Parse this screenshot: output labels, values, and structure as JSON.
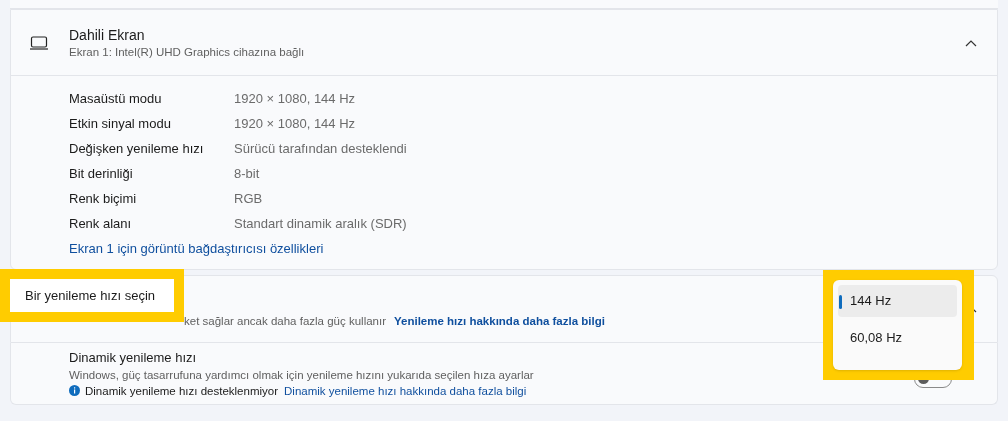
{
  "display": {
    "title": "Dahili Ekran",
    "subtitle": "Ekran 1: Intel(R) UHD Graphics cihazına bağlı",
    "expanded": true,
    "properties": [
      {
        "label": "Masaüstü modu",
        "value": "1920 × 1080, 144 Hz"
      },
      {
        "label": "Etkin sinyal modu",
        "value": "1920 × 1080, 144 Hz"
      },
      {
        "label": "Değişken yenileme hızı",
        "value": "Sürücü tarafından desteklendi"
      },
      {
        "label": "Bit derinliği",
        "value": "8-bit"
      },
      {
        "label": "Renk biçimi",
        "value": "RGB"
      },
      {
        "label": "Renk alanı",
        "value": "Standart dinamik aralık (SDR)"
      }
    ],
    "link": "Ekran 1 için görüntü bağdaştırıcısı özellikleri"
  },
  "refresh_rate": {
    "callout_label": "Bir yenileme hızı seçin",
    "subtitle": "ket sağlar ancak daha fazla güç kullanır",
    "link": "Yenileme hızı hakkında daha fazla bilgi",
    "expanded": true,
    "options": [
      {
        "label": "144 Hz",
        "selected": true
      },
      {
        "label": "60,08 Hz",
        "selected": false
      }
    ]
  },
  "dynamic_refresh": {
    "title": "Dinamik yenileme hızı",
    "description": "Windows, güç tasarrufuna yardımcı olmak için yenileme hızını yukarıda seçilen hıza ayarlar",
    "info": "Dinamik yenileme hızı desteklenmiyor",
    "link": "Dinamik yenileme hızı hakkında daha fazla bilgi",
    "on": false
  }
}
